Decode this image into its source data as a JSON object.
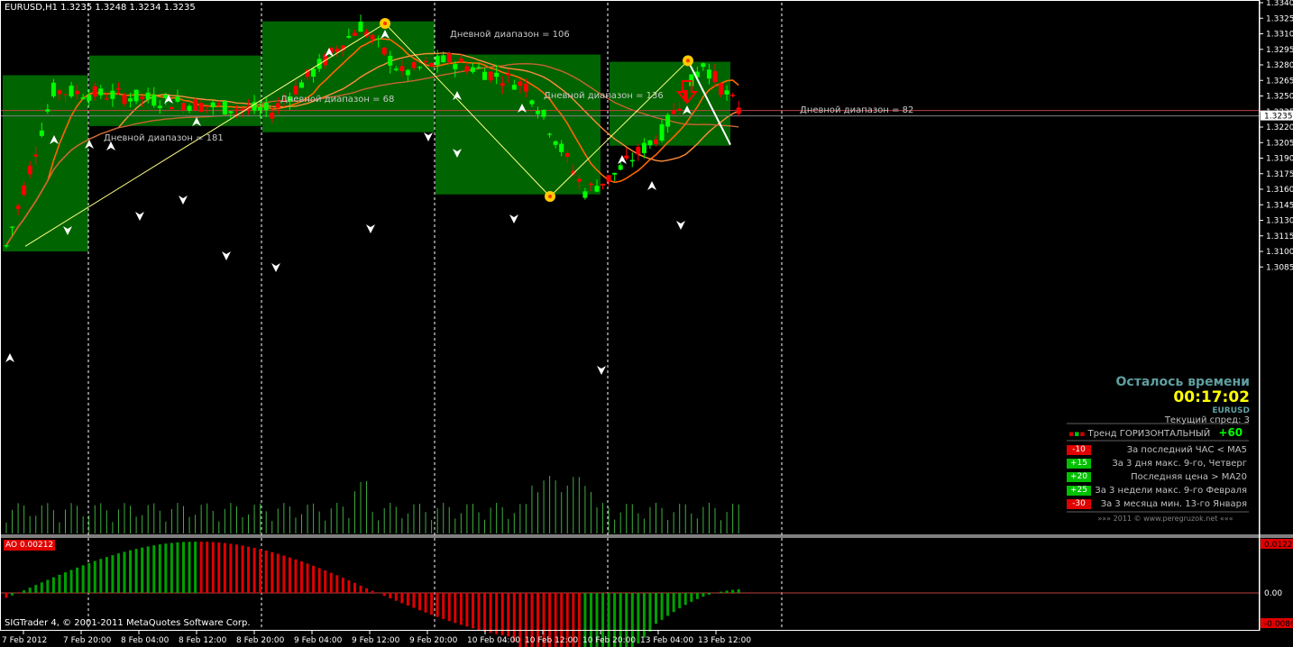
{
  "window": {
    "symbol_header": "EURUSD,H1  1.3235 1.3248 1.3234 1.3235",
    "copyright": "SIGTrader 4, © 2001-2011 MetaQuotes Software Corp.",
    "ao_label": "AO 0.00212"
  },
  "chart_data": {
    "type": "candlestick",
    "symbol": "EURUSD",
    "timeframe": "H1",
    "ylim": [
      1.3085,
      1.334
    ],
    "price_ticks": [
      "1.3340",
      "1.3325",
      "1.3310",
      "1.3295",
      "1.3280",
      "1.3265",
      "1.3250",
      "1.3235",
      "1.3220",
      "1.3205",
      "1.3190",
      "1.3175",
      "1.3160",
      "1.3145",
      "1.3130",
      "1.3115",
      "1.3100",
      "1.3085"
    ],
    "current_price": "1.3235",
    "current_price_line": 1.3236,
    "time_ticks": [
      "7 Feb 2012",
      "7 Feb 20:00",
      "8 Feb 04:00",
      "8 Feb 12:00",
      "8 Feb 20:00",
      "9 Feb 04:00",
      "9 Feb 12:00",
      "9 Feb 20:00",
      "10 Feb 04:00",
      "10 Feb 12:00",
      "10 Feb 20:00",
      "13 Feb 04:00",
      "13 Feb 12:00"
    ],
    "daily_ranges": [
      {
        "label": "",
        "high": 1.327,
        "low": 1.31
      },
      {
        "label": "Дневной диапазон = 181",
        "high": 1.3289,
        "low": 1.3221
      },
      {
        "label": "Дневной диапазон = 68",
        "high": 1.3322,
        "low": 1.3215
      },
      {
        "label": "Дневной диапазон = 106",
        "high": 1.329,
        "low": 1.3155
      },
      {
        "label": "Дневной диапазон = 136",
        "high": 1.3283,
        "low": 1.3202
      }
    ],
    "daily_range_future_label": "Дневной диапазон = 82",
    "zigzag_prices": [
      1.3105,
      1.332,
      1.3153,
      1.3284,
      1.3203
    ],
    "ao_axis_labels": [
      "0.01222",
      "0.00",
      "-0.00861"
    ],
    "ao_range": [
      -0.00861,
      0.01222
    ]
  },
  "panel": {
    "remaining_title": "Осталось времени",
    "remaining_time": "00:17:02",
    "symbol": "EURUSD",
    "spread": "Текущий спред: 3",
    "trend_label": "Тренд ГОРИЗОНТАЛЬНЫЙ",
    "trend_score": "+60",
    "rows": [
      {
        "badge": "-10",
        "color": "#e00000",
        "text": "За последний ЧАС < MA5"
      },
      {
        "badge": "+15",
        "color": "#00c000",
        "text": "За 3 дня макс. 9-го, Четверг"
      },
      {
        "badge": "+20",
        "color": "#00c000",
        "text": "Последняя цена > MA20"
      },
      {
        "badge": "+25",
        "color": "#00c000",
        "text": "За 3 недели макс. 9-го Февраля"
      },
      {
        "badge": "-30",
        "color": "#e00000",
        "text": "За 3 месяца мин. 13-го Января"
      }
    ],
    "footer": "»»»    2011  ©  www.peregruzok.net    «««"
  },
  "colors": {
    "bull": "#00ff00",
    "bear": "#ff0000",
    "range_box": "#006400",
    "zigzag": "#ffff80",
    "ma_fast": "#ff6600",
    "ma_mid": "#ff8c3a",
    "ma_slow": "#c86432",
    "grid": "#ffffff",
    "axis_text": "#ffffff"
  }
}
